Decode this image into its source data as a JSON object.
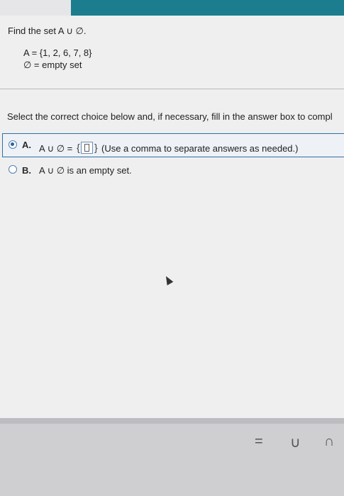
{
  "question": {
    "prompt": "Find the set A ∪ ∅.",
    "set_a": "A = {1, 2, 6, 7, 8}",
    "empty_set": "∅ = empty set"
  },
  "instruction": "Select the correct choice below and, if necessary, fill in the answer box to compl",
  "choices": [
    {
      "letter": "A.",
      "prefix": "A ∪ ∅ =",
      "hint": "(Use a comma to separate answers as needed.)",
      "selected": true
    },
    {
      "letter": "B.",
      "text": "A ∪ ∅ is an empty set.",
      "selected": false
    }
  ],
  "answer_box": {
    "open_brace": "{",
    "close_brace": "}",
    "value": ""
  },
  "toolbar": {
    "equals": "=",
    "union": "∪",
    "intersection": "∩"
  }
}
